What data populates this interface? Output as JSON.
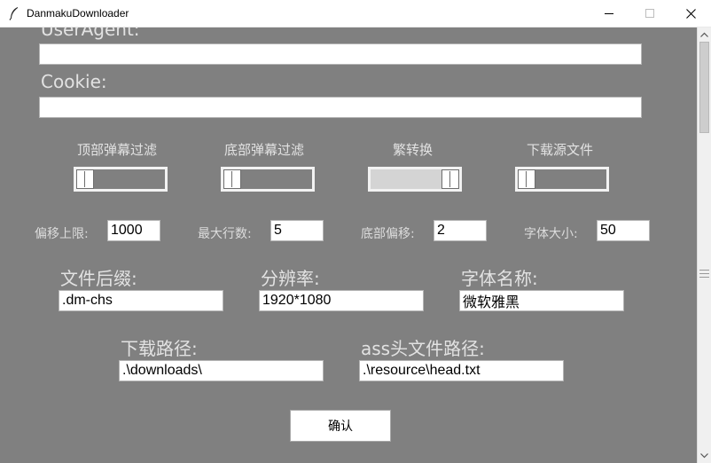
{
  "window": {
    "title": "DanmakuDownloader",
    "icon": "feather-icon"
  },
  "fields": {
    "user_agent": {
      "label": "UserAgent:",
      "value": ""
    },
    "cookie": {
      "label": "Cookie:",
      "value": ""
    }
  },
  "toggles": [
    {
      "label": "顶部弹幕过滤",
      "state": "off"
    },
    {
      "label": "底部弹幕过滤",
      "state": "off"
    },
    {
      "label": "繁转换",
      "state": "on"
    },
    {
      "label": "下载源文件",
      "state": "off"
    }
  ],
  "numbers": {
    "offset_limit": {
      "label": "偏移上限:",
      "value": "1000"
    },
    "max_lines": {
      "label": "最大行数:",
      "value": "5"
    },
    "bottom_offset": {
      "label": "底部偏移:",
      "value": "2"
    },
    "font_size": {
      "label": "字体大小:",
      "value": "50"
    }
  },
  "options": {
    "file_suffix": {
      "label": "文件后缀:",
      "value": ".dm-chs"
    },
    "resolution": {
      "label": "分辨率:",
      "value": "1920*1080"
    },
    "font_name": {
      "label": "字体名称:",
      "value": "微软雅黑"
    }
  },
  "paths": {
    "download_path": {
      "label": "下载路径:",
      "value": ".\\downloads\\"
    },
    "ass_head_path": {
      "label": "ass头文件路径:",
      "value": ".\\resource\\head.txt"
    }
  },
  "confirm_label": "确认",
  "colors": {
    "background": "#808080",
    "label": "#e2e2e2",
    "toggle_border": "#f2f2f2",
    "toggle_on_fill": "#d4d4d4"
  }
}
